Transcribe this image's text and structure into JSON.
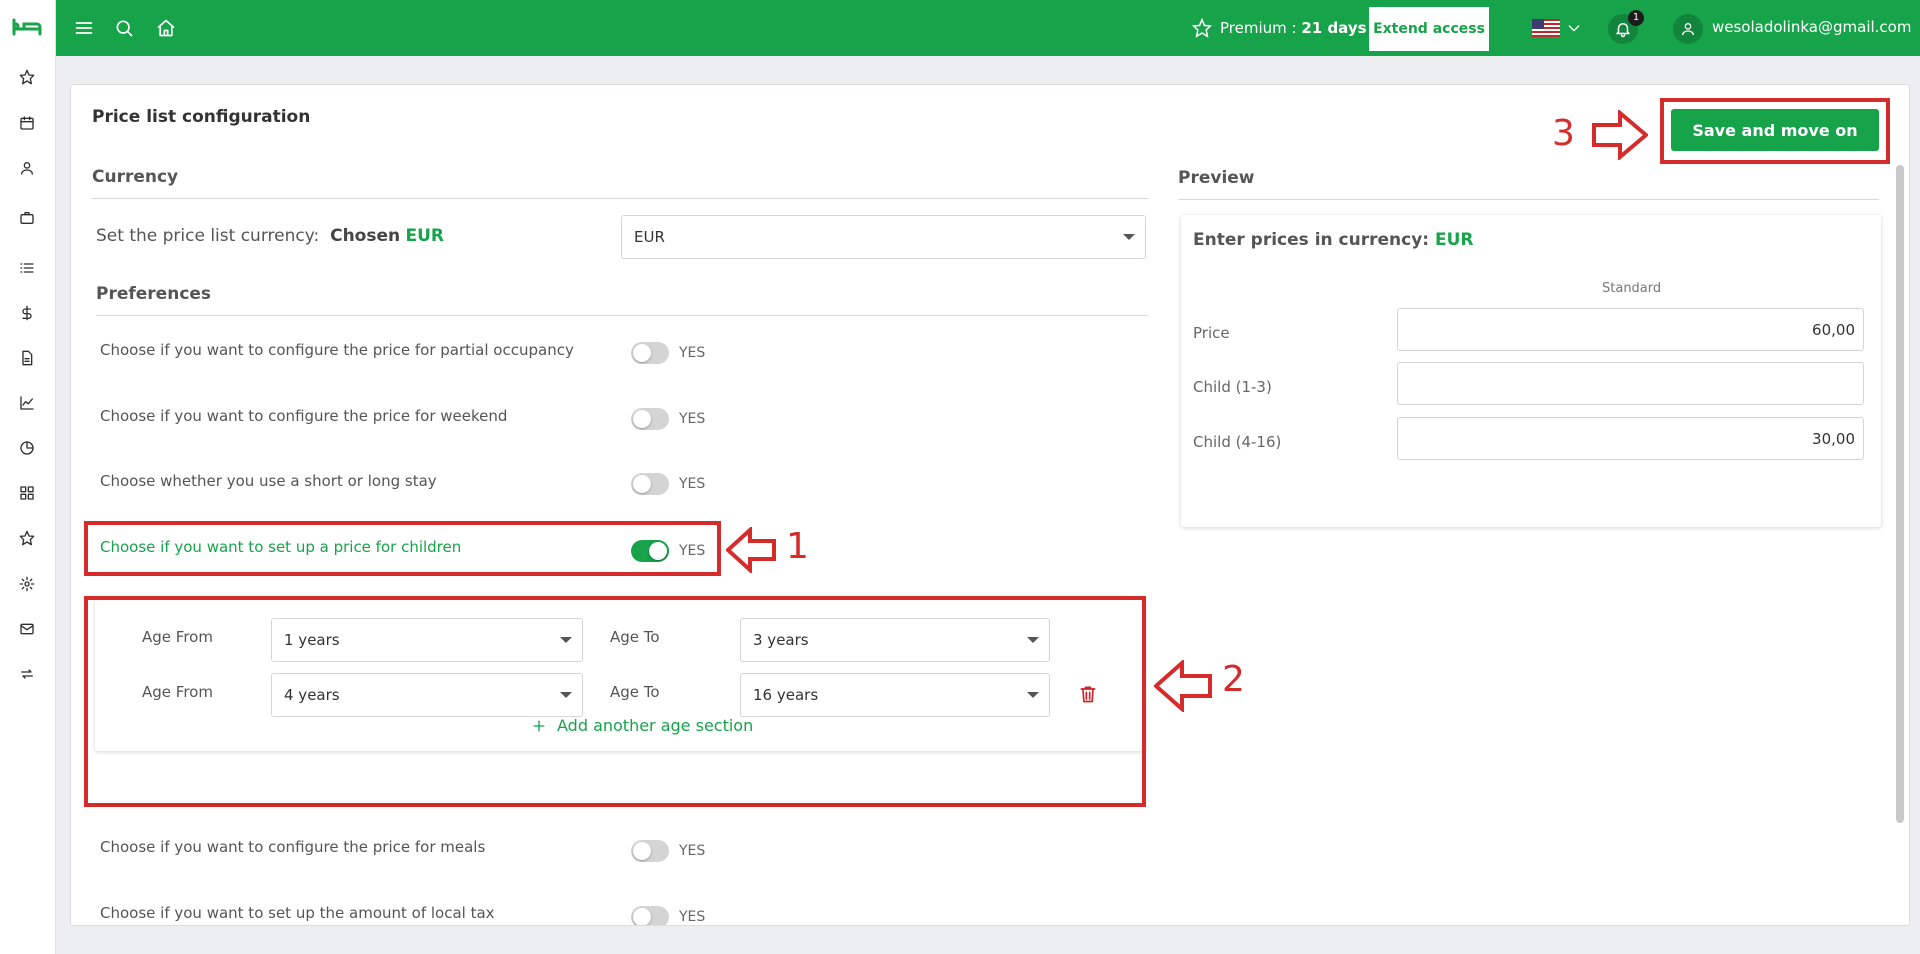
{
  "topbar": {
    "premium_label": "Premium : ",
    "premium_days": "21 days",
    "extend_label": "Extend access",
    "notification_count": "1",
    "user_email": "wesoladolinka@gmail.com"
  },
  "page": {
    "title": "Price list configuration",
    "save_label": "Save and move on"
  },
  "currency": {
    "section_title": "Currency",
    "label": "Set the price list currency:",
    "chosen_prefix": "Chosen",
    "chosen_value": "EUR",
    "select_value": "EUR"
  },
  "preferences": {
    "section_title": "Preferences",
    "items": [
      {
        "label": "Choose if you want to configure the price for partial occupancy",
        "toggle_label": "YES",
        "on": false
      },
      {
        "label": "Choose if you want to configure the price for weekend",
        "toggle_label": "YES",
        "on": false
      },
      {
        "label": "Choose whether you use a short or long stay",
        "toggle_label": "YES",
        "on": false
      },
      {
        "label": "Choose if you want to set up a price for children",
        "toggle_label": "YES",
        "on": true
      },
      {
        "label": "Choose if you want to configure the price for meals",
        "toggle_label": "YES",
        "on": false
      },
      {
        "label": "Choose if you want to set up the amount of local tax",
        "toggle_label": "YES",
        "on": false
      }
    ]
  },
  "age_sections": {
    "from_label": "Age From",
    "to_label": "Age To",
    "rows": [
      {
        "from": "1 years",
        "to": "3 years"
      },
      {
        "from": "4 years",
        "to": "16 years"
      }
    ],
    "add_label": "Add another age section"
  },
  "preview": {
    "section_title": "Preview",
    "heading_prefix": "Enter prices in currency:",
    "heading_currency": "EUR",
    "column_label": "Standard",
    "rows": [
      {
        "label": "Price",
        "value": "60,00"
      },
      {
        "label": "Child (1-3)",
        "value": ""
      },
      {
        "label": "Child (4-16)",
        "value": "30,00"
      }
    ]
  },
  "annotations": [
    "1",
    "2",
    "3"
  ],
  "colors": {
    "brand_green": "#17a34a",
    "annotation_red": "#d52b2b"
  },
  "icons": {
    "sidebar": [
      "bed-logo-icon",
      "star-icon",
      "calendar-icon",
      "user-icon",
      "briefcase-icon",
      "list-icon",
      "dollar-icon",
      "document-icon",
      "chart-line-icon",
      "pie-chart-icon",
      "grid-icon",
      "star-icon",
      "gear-icon",
      "mail-icon",
      "sync-icon"
    ],
    "topbar": [
      "menu-icon",
      "search-icon",
      "home-icon",
      "star-icon",
      "us-flag-icon",
      "chevron-down-icon",
      "bell-icon",
      "user-icon"
    ]
  }
}
